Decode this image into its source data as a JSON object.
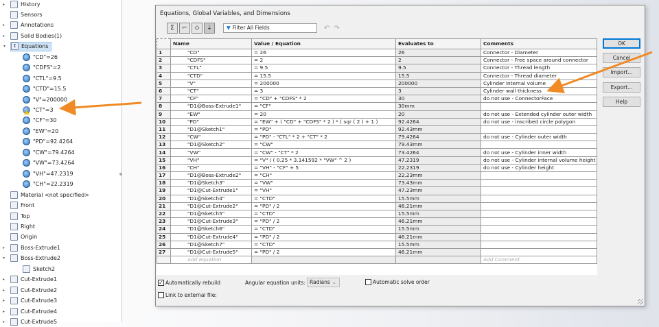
{
  "tree": {
    "items": [
      {
        "label": "History",
        "icon": "history-folder-icon",
        "expander": "▸"
      },
      {
        "label": "Sensors",
        "icon": "sensors-folder-icon",
        "expander": ""
      },
      {
        "label": "Annotations",
        "icon": "annotations-folder-icon",
        "expander": "▸"
      },
      {
        "label": "Solid Bodies(1)",
        "icon": "solid-bodies-folder-icon",
        "expander": "▸"
      },
      {
        "label": "Equations",
        "icon": "equations-folder-icon",
        "expander": "▾",
        "selected": true
      },
      {
        "label": "\"CD\"=26",
        "icon": "global-variable-icon",
        "child": true
      },
      {
        "label": "\"CDFS\"=2",
        "icon": "global-variable-icon",
        "child": true
      },
      {
        "label": "\"CTL\"=9.5",
        "icon": "global-variable-icon",
        "child": true
      },
      {
        "label": "\"CTD\"=15.5",
        "icon": "global-variable-icon",
        "child": true
      },
      {
        "label": "\"V\"=200000",
        "icon": "global-variable-icon",
        "child": true
      },
      {
        "label": "\"CT\"=3",
        "icon": "global-variable-warning-icon",
        "child": true,
        "warning": true
      },
      {
        "label": "\"CF\"=30",
        "icon": "global-variable-icon",
        "child": true
      },
      {
        "label": "\"EW\"=20",
        "icon": "global-variable-icon",
        "child": true
      },
      {
        "label": "\"PD\"=92.4264",
        "icon": "global-variable-icon",
        "child": true
      },
      {
        "label": "\"CW\"=79.4264",
        "icon": "global-variable-icon",
        "child": true
      },
      {
        "label": "\"VW\"=73.4264",
        "icon": "global-variable-icon",
        "child": true
      },
      {
        "label": "\"VH\"=47.2319",
        "icon": "global-variable-icon",
        "child": true
      },
      {
        "label": "\"CH\"=22.2319",
        "icon": "global-variable-icon",
        "child": true
      },
      {
        "label": "Material <not specified>",
        "icon": "material-icon",
        "expander": ""
      },
      {
        "label": "Front",
        "icon": "plane-icon",
        "expander": ""
      },
      {
        "label": "Top",
        "icon": "plane-icon",
        "expander": ""
      },
      {
        "label": "Right",
        "icon": "plane-icon",
        "expander": ""
      },
      {
        "label": "Origin",
        "icon": "origin-icon",
        "expander": ""
      },
      {
        "label": "Boss-Extrude1",
        "icon": "boss-extrude-icon",
        "expander": "▸"
      },
      {
        "label": "Boss-Extrude2",
        "icon": "boss-extrude-icon",
        "expander": "▾"
      },
      {
        "label": "Sketch2",
        "icon": "sketch-icon",
        "child": true
      },
      {
        "label": "Cut-Extrude1",
        "icon": "cut-extrude-icon",
        "expander": "▸"
      },
      {
        "label": "Cut-Extrude2",
        "icon": "cut-extrude-icon",
        "expander": "▸"
      },
      {
        "label": "Cut-Extrude3",
        "icon": "cut-extrude-icon",
        "expander": "▸"
      },
      {
        "label": "Cut-Extrude4",
        "icon": "cut-extrude-icon",
        "expander": "▸"
      },
      {
        "label": "Cut-Extrude5",
        "icon": "cut-extrude-icon",
        "expander": "▸"
      }
    ]
  },
  "dialog": {
    "title": "Equations, Global Variables, and Dimensions",
    "toolbar": {
      "filter_placeholder": "Filter All Fields",
      "icons": [
        "equation-view-icon",
        "sketch-equation-view-icon",
        "dimension-view-icon",
        "ordered-view-icon",
        "undo-icon",
        "redo-icon"
      ]
    },
    "columns": [
      "Name",
      "Value / Equation",
      "Evaluates to",
      "Comments"
    ],
    "rows": [
      [
        "1",
        "\"CD\"",
        "= 26",
        "26",
        "Connector - Diameter"
      ],
      [
        "2",
        "\"CDFS\"",
        "= 2",
        "2",
        "Connector - Free space around connector"
      ],
      [
        "3",
        "\"CTL\"",
        "= 9.5",
        "9.5",
        "Connector - Thread length"
      ],
      [
        "4",
        "\"CTD\"",
        "= 15.5",
        "15.5",
        "Connector - Thread diameter"
      ],
      [
        "5",
        "\"V\"",
        "= 200000",
        "200000",
        "Cylinder internal volume"
      ],
      [
        "6",
        "\"CT\"",
        "= 3",
        "3",
        "Cylinder wall thickness"
      ],
      [
        "7",
        "\"CF\"",
        "= \"CD\" + \"CDFS\" * 2",
        "30",
        "do not use - ConnectorFace"
      ],
      [
        "8",
        "\"D1@Boss-Extrude1\"",
        "= \"CF\"",
        "30mm",
        ""
      ],
      [
        "9",
        "\"EW\"",
        "= 20",
        "20",
        "do not use - Extended cylinder outer width"
      ],
      [
        "10",
        "\"PD\"",
        "= \"EW\" + ( \"CD\" + \"CDFS\" * 2 ) * ( sqr ( 2 ) + 1 )",
        "92.4264",
        "do not use - inscribed circle polygon"
      ],
      [
        "11",
        "\"D1@Sketch1\"",
        "= \"PD\"",
        "92.43mm",
        ""
      ],
      [
        "12",
        "\"CW\"",
        "= \"PD\" - \"CTL\" * 2 + \"CT\" * 2",
        "79.4264",
        "do not use - Cylinder outer width"
      ],
      [
        "13",
        "\"D1@Sketch2\"",
        "= \"CW\"",
        "79.43mm",
        ""
      ],
      [
        "14",
        "\"VW\"",
        "= \"CW\" - \"CT\" * 2",
        "73.4264",
        "do not use - Cylinder inner width"
      ],
      [
        "15",
        "\"VH\"",
        "= \"V\" / ( 0.25 * 3.141592 * \"VW\" ^ 2 )",
        "47.2319",
        "do not use - Cylinder internal volume height"
      ],
      [
        "16",
        "\"CH\"",
        "= \"VH\" - \"CF\" + 5",
        "22.2319",
        "do not use - Cylinder height"
      ],
      [
        "17",
        "\"D1@Boss-Extrude2\"",
        "= \"CH\"",
        "22.23mm",
        ""
      ],
      [
        "18",
        "\"D1@Sketch3\"",
        "= \"VW\"",
        "73.43mm",
        ""
      ],
      [
        "19",
        "\"D1@Cut-Extrude1\"",
        "= \"VH\"",
        "47.23mm",
        ""
      ],
      [
        "20",
        "\"D1@Sketch4\"",
        "= \"CTD\"",
        "15.5mm",
        ""
      ],
      [
        "21",
        "\"D1@Cut-Extrude2\"",
        "= \"PD\" / 2",
        "46.21mm",
        ""
      ],
      [
        "22",
        "\"D1@Sketch5\"",
        "= \"CTD\"",
        "15.5mm",
        ""
      ],
      [
        "23",
        "\"D1@Cut-Extrude3\"",
        "= \"PD\" / 2",
        "46.21mm",
        ""
      ],
      [
        "24",
        "\"D1@Sketch6\"",
        "= \"CTD\"",
        "15.5mm",
        ""
      ],
      [
        "25",
        "\"D1@Cut-Extrude4\"",
        "= \"PD\" / 2",
        "46.21mm",
        ""
      ],
      [
        "26",
        "\"D1@Sketch7\"",
        "= \"CTD\"",
        "15.5mm",
        ""
      ],
      [
        "27",
        "\"D1@Cut-Extrude5\"",
        "= \"PD\" / 2",
        "46.21mm",
        ""
      ]
    ],
    "add_equation_placeholder": "Add equation",
    "add_comment_placeholder": "Add Comment",
    "buttons": {
      "ok": "OK",
      "cancel": "Cancel",
      "import": "Import...",
      "export": "Export...",
      "help": "Help"
    },
    "options": {
      "auto_rebuild": {
        "label": "Automatically rebuild",
        "checked": true
      },
      "link_external": {
        "label": "Link to external file:",
        "checked": false
      },
      "auto_solve": {
        "label": "Automatic solve order",
        "checked": false
      },
      "angular_units_label": "Angular equation units:",
      "angular_units_value": "Radians"
    }
  },
  "annotation_color": "#f08a24"
}
